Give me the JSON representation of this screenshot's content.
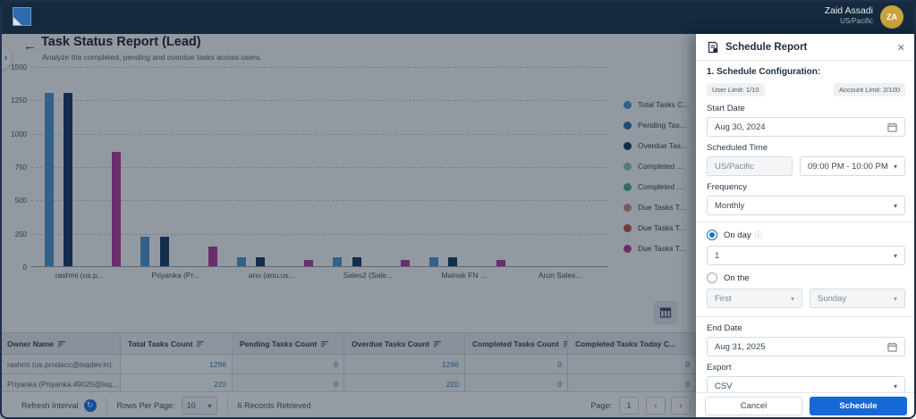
{
  "topbar": {
    "user_name": "Zaid Assadi",
    "user_region": "US/Pacific",
    "avatar_initials": "ZA"
  },
  "header": {
    "title": "Task Status Report (Lead)",
    "subtitle": "Analyze the completed, pending and overdue tasks across users."
  },
  "icons": {
    "back": "←",
    "chevron_right": "›",
    "close": "✕",
    "caret": "▾",
    "refresh": "↻",
    "info": "ⓘ",
    "prev": "‹",
    "next": "›"
  },
  "chart_data": {
    "type": "bar",
    "categories": [
      "rashmi (us.p...",
      "Priyanka (Pr...",
      "anu (anu.us...",
      "Sales2 (Sale...",
      "Mainak FN ...",
      "Arun Sales..."
    ],
    "series": [
      {
        "name": "Total Tasks C...",
        "color": "#4f97d0",
        "values": [
          1296,
          220,
          70,
          65,
          65,
          0
        ]
      },
      {
        "name": "Pending Tas...",
        "color": "#2f6fae",
        "values": [
          0,
          0,
          0,
          0,
          0,
          0
        ]
      },
      {
        "name": "Overdue Tas...",
        "color": "#173f66",
        "values": [
          1296,
          220,
          70,
          65,
          70,
          0
        ]
      },
      {
        "name": "Completed ...",
        "color": "#7ecab4",
        "values": [
          0,
          0,
          0,
          0,
          0,
          0
        ]
      },
      {
        "name": "Completed ...",
        "color": "#4ca894",
        "values": [
          0,
          0,
          0,
          0,
          0,
          0
        ]
      },
      {
        "name": "Due Tasks T...",
        "color": "#c08d7c",
        "values": [
          0,
          0,
          0,
          0,
          0,
          0
        ]
      },
      {
        "name": "Due Tasks T...",
        "color": "#b65848",
        "values": [
          0,
          0,
          0,
          0,
          0,
          0
        ]
      },
      {
        "name": "Due Tasks T...",
        "color": "#b23d9b",
        "values": [
          860,
          145,
          45,
          50,
          50,
          0
        ]
      }
    ],
    "xlabel": "",
    "ylabel": "",
    "ylim": [
      0,
      1500
    ],
    "yticks": [
      0,
      250,
      500,
      750,
      1000,
      1250,
      1500
    ],
    "grid": "horizontal-dashed",
    "legend_position": "right"
  },
  "table": {
    "headers": [
      "Owner Name",
      "Total Tasks Count",
      "Pending Tasks Count",
      "Overdue Tasks Count",
      "Completed Tasks Count",
      "Completed Tasks Today C..."
    ],
    "sortable_cols": [
      0,
      1,
      2,
      3,
      4
    ],
    "sorted_col": 1,
    "link_cols": [
      1,
      3
    ],
    "rows": [
      [
        "rashmi (us.prodacc@lsqdev.in)",
        "1296",
        "0",
        "1296",
        "0",
        "0"
      ],
      [
        "Priyanka (Priyanka.49025@lsq...",
        "220",
        "0",
        "220",
        "0",
        "0"
      ]
    ]
  },
  "footer": {
    "refresh_label": "Refresh Interval",
    "rows_per_page_label": "Rows Per Page:",
    "rows_per_page_value": "10",
    "records": "6 Records Retrieved",
    "page_label": "Page:",
    "page_value": "1"
  },
  "panel": {
    "title": "Schedule Report",
    "section_title": "1. Schedule Configuration:",
    "user_limit": "User Limit: 1/10",
    "account_limit": "Account Limit: 2/100",
    "start_date_label": "Start Date",
    "start_date_value": "Aug 30, 2024",
    "scheduled_time_label": "Scheduled Time",
    "timezone_value": "US/Pacific",
    "time_range_value": "09:00 PM - 10:00 PM",
    "frequency_label": "Frequency",
    "frequency_value": "Monthly",
    "on_day_label": "On day",
    "on_day_value": "1",
    "on_the_label": "On the",
    "on_the_ordinal_value": "First",
    "on_the_weekday_value": "Sunday",
    "end_date_label": "End Date",
    "end_date_value": "Aug 31, 2025",
    "export_label": "Export",
    "export_value": "CSV",
    "cancel_label": "Cancel",
    "schedule_label": "Schedule"
  },
  "colors": {
    "topbar": "#152a3e",
    "accent": "#1a73e8",
    "schedule_button": "#1668d6",
    "avatar": "#c9a33e",
    "link": "#2f7fc1"
  }
}
